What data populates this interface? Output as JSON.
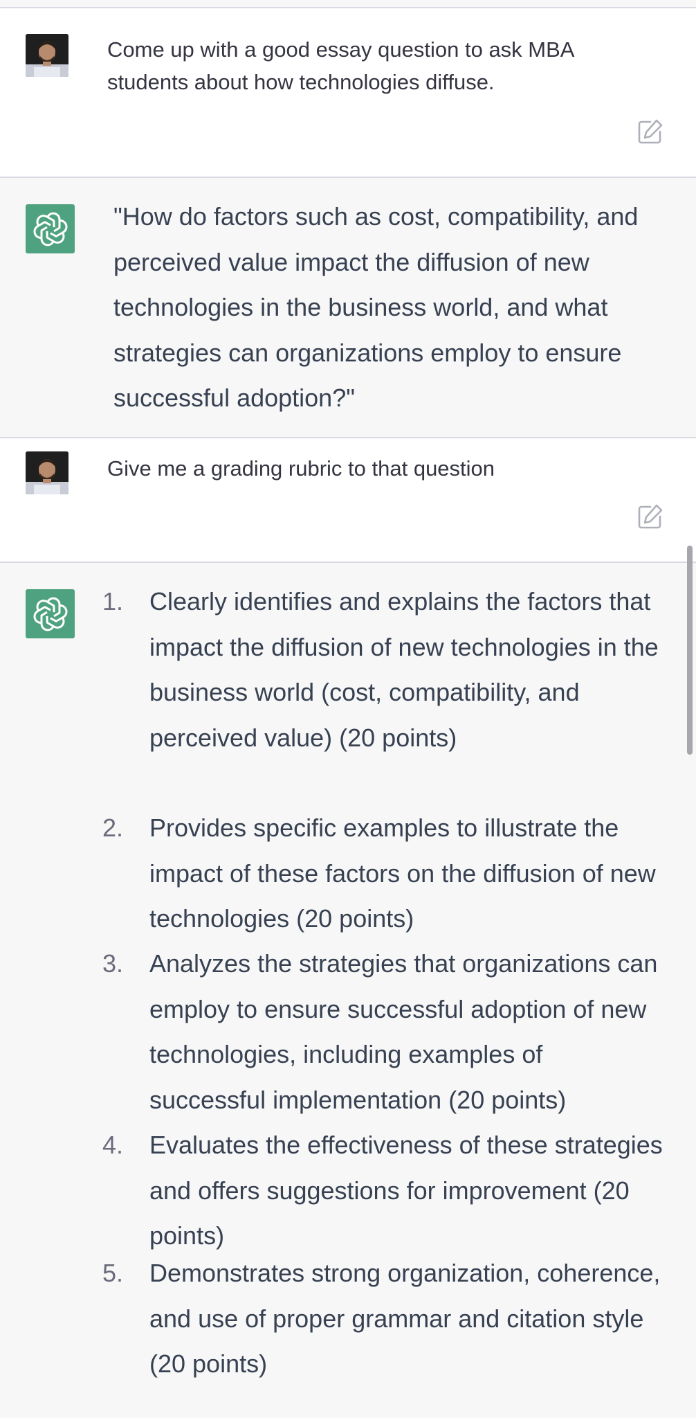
{
  "conversation": {
    "messages": [
      {
        "role": "user",
        "text": "Come up with a good essay question to ask MBA students about how technologies diffuse."
      },
      {
        "role": "assistant",
        "text": "\"How do factors such as cost, compatibility, and perceived value impact the diffusion of new technologies in the business world, and what strategies can organizations employ to ensure successful adoption?\""
      },
      {
        "role": "user",
        "text": "Give me a grading rubric to that question"
      },
      {
        "role": "assistant",
        "rubric": [
          {
            "number": "1.",
            "text": "Clearly identifies and explains the factors that impact the diffusion of new technologies in the business world (cost, compatibility, and perceived value) (20 points)"
          },
          {
            "number": "2.",
            "text": "Provides specific examples to illustrate the impact of these factors on the diffusion of new technologies (20 points)"
          },
          {
            "number": "3.",
            "text": "Analyzes the strategies that organizations can employ to ensure successful adoption of new technologies, including examples of successful implementation (20 points)"
          },
          {
            "number": "4.",
            "text": "Evaluates the effectiveness of these strategies and offers suggestions for improvement (20 points)"
          },
          {
            "number": "5.",
            "text": "Demonstrates strong organization, coherence, and use of proper grammar and citation style (20 points)"
          }
        ]
      }
    ]
  },
  "icons": {
    "user_avatar": "user-avatar",
    "assistant_avatar": "openai-logo-icon",
    "edit": "edit-icon"
  },
  "colors": {
    "assistant_avatar_bg": "#4fa27f",
    "user_bg": "#ffffff",
    "assistant_bg": "#f7f7f8"
  }
}
